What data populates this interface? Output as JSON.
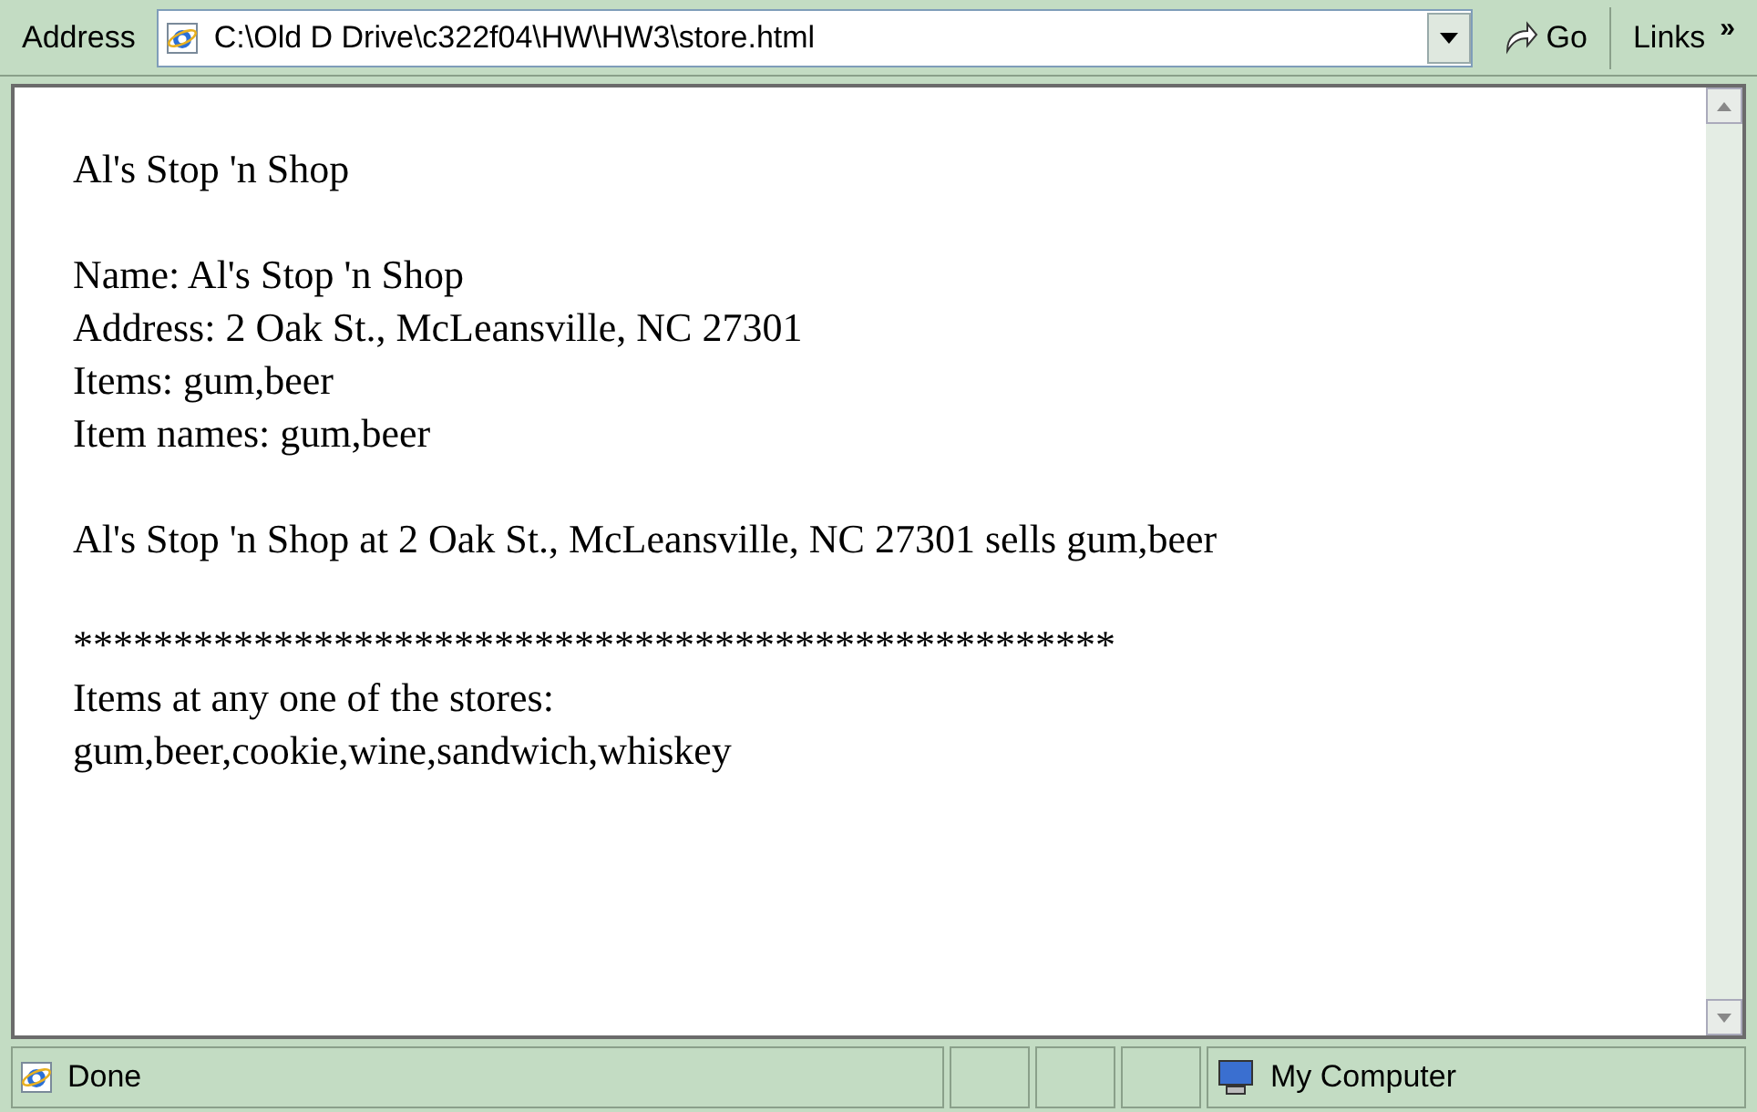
{
  "address_bar": {
    "label": "Address",
    "url": "C:\\Old D Drive\\c322f04\\HW\\HW3\\store.html",
    "go": "Go",
    "links": "Links",
    "more": "»"
  },
  "page": {
    "heading": "Al's Stop 'n Shop",
    "details": [
      "Name: Al's Stop 'n Shop",
      "Address: 2 Oak St., McLeansville, NC 27301",
      "Items: gum,beer",
      "Item names: gum,beer"
    ],
    "summary": "Al's Stop 'n Shop at 2 Oak St., McLeansville, NC 27301 sells gum,beer",
    "separator": "****************************************************",
    "all_items_label": "Items at any one of the stores:",
    "all_items": "gum,beer,cookie,wine,sandwich,whiskey"
  },
  "status_bar": {
    "status": "Done",
    "zone": "My Computer"
  }
}
